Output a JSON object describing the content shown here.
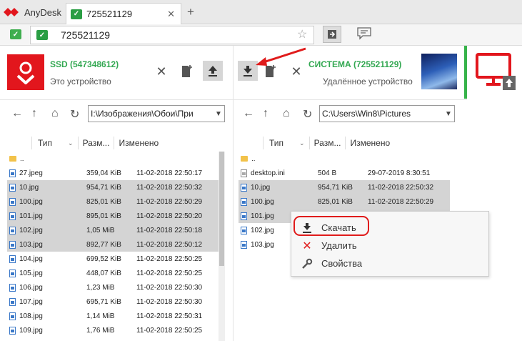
{
  "app": {
    "name": "AnyDesk",
    "accent": "#e2161d"
  },
  "tab": {
    "title": "725521129",
    "close": "✕",
    "new": "+"
  },
  "address": {
    "value": "725521129"
  },
  "local": {
    "name": "SSD (547348612)",
    "subtitle": "Это устройство",
    "path": "I:\\Изображения\\Обои\\При"
  },
  "remote": {
    "name": "СИСТЕМА (725521129)",
    "subtitle": "Удалённое устройство",
    "path": "C:\\Users\\Win8\\Pictures"
  },
  "columns": {
    "type": "Тип",
    "size": "Разм...",
    "modified": "Изменено"
  },
  "local_files": [
    {
      "name": "..",
      "size": "",
      "date": "",
      "kind": "folder",
      "sel": false
    },
    {
      "name": "27.jpeg",
      "size": "359,04 KiB",
      "date": "11-02-2018 22:50:17",
      "kind": "img",
      "sel": false
    },
    {
      "name": "10.jpg",
      "size": "954,71 KiB",
      "date": "11-02-2018 22:50:32",
      "kind": "img",
      "sel": true
    },
    {
      "name": "100.jpg",
      "size": "825,01 KiB",
      "date": "11-02-2018 22:50:29",
      "kind": "img",
      "sel": true
    },
    {
      "name": "101.jpg",
      "size": "895,01 KiB",
      "date": "11-02-2018 22:50:20",
      "kind": "img",
      "sel": true
    },
    {
      "name": "102.jpg",
      "size": "1,05 MiB",
      "date": "11-02-2018 22:50:18",
      "kind": "img",
      "sel": true
    },
    {
      "name": "103.jpg",
      "size": "892,77 KiB",
      "date": "11-02-2018 22:50:12",
      "kind": "img",
      "sel": true
    },
    {
      "name": "104.jpg",
      "size": "699,52 KiB",
      "date": "11-02-2018 22:50:25",
      "kind": "img",
      "sel": false
    },
    {
      "name": "105.jpg",
      "size": "448,07 KiB",
      "date": "11-02-2018 22:50:25",
      "kind": "img",
      "sel": false
    },
    {
      "name": "106.jpg",
      "size": "1,23 MiB",
      "date": "11-02-2018 22:50:30",
      "kind": "img",
      "sel": false
    },
    {
      "name": "107.jpg",
      "size": "695,71 KiB",
      "date": "11-02-2018 22:50:30",
      "kind": "img",
      "sel": false
    },
    {
      "name": "108.jpg",
      "size": "1,14 MiB",
      "date": "11-02-2018 22:50:31",
      "kind": "img",
      "sel": false
    },
    {
      "name": "109.jpg",
      "size": "1,76 MiB",
      "date": "11-02-2018 22:50:25",
      "kind": "img",
      "sel": false
    }
  ],
  "remote_files": [
    {
      "name": "..",
      "size": "",
      "date": "",
      "kind": "folder",
      "sel": false
    },
    {
      "name": "desktop.ini",
      "size": "504 B",
      "date": "29-07-2019 8:30:51",
      "kind": "ini",
      "sel": false
    },
    {
      "name": "10.jpg",
      "size": "954,71 KiB",
      "date": "11-02-2018 22:50:32",
      "kind": "img",
      "sel": true
    },
    {
      "name": "100.jpg",
      "size": "825,01 KiB",
      "date": "11-02-2018 22:50:29",
      "kind": "img",
      "sel": true
    },
    {
      "name": "101.jpg",
      "size": "",
      "date": "",
      "kind": "img",
      "sel": true
    },
    {
      "name": "102.jpg",
      "size": "",
      "date": "",
      "kind": "img",
      "sel": false
    },
    {
      "name": "103.jpg",
      "size": "",
      "date": "",
      "kind": "img",
      "sel": false
    }
  ],
  "context_menu": {
    "download": "Скачать",
    "delete": "Удалить",
    "properties": "Свойства"
  }
}
